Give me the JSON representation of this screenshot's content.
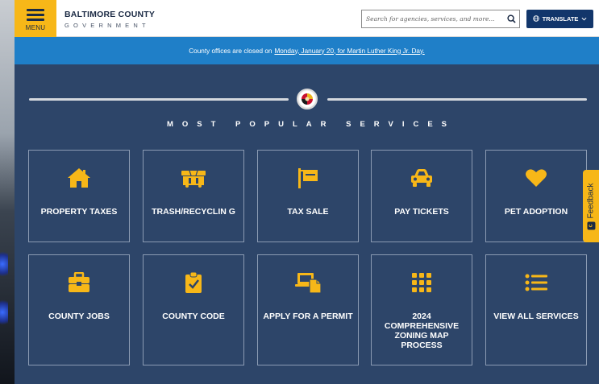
{
  "header": {
    "menu_label": "MENU",
    "brand_name": "BALTIMORE COUNTY",
    "brand_sub": "GOVERNMENT",
    "search_placeholder": "Search for agencies, services, and more...",
    "translate_label": "TRANSLATE"
  },
  "alert": {
    "text": "County offices are closed on",
    "link": "Monday, January 20, for Martin Luther King Jr. Day."
  },
  "services": {
    "title": "MOST POPULAR SERVICES",
    "tiles": [
      {
        "label": "PROPERTY TAXES",
        "icon": "house-icon"
      },
      {
        "label": "TRASH/RECYCLIN G",
        "icon": "dumpster-icon"
      },
      {
        "label": "TAX SALE",
        "icon": "sign-icon"
      },
      {
        "label": "PAY TICKETS",
        "icon": "car-icon"
      },
      {
        "label": "PET ADOPTION",
        "icon": "heart-icon"
      },
      {
        "label": "COUNTY JOBS",
        "icon": "briefcase-icon"
      },
      {
        "label": "COUNTY CODE",
        "icon": "clipboard-check-icon"
      },
      {
        "label": "APPLY FOR A PERMIT",
        "icon": "laptop-document-icon"
      },
      {
        "label": "2024 COMPREHENSIVE ZONING MAP PROCESS",
        "icon": "grid-icon"
      },
      {
        "label": "VIEW ALL SERVICES",
        "icon": "list-icon"
      }
    ]
  },
  "feedback": {
    "label": "Feedback"
  },
  "colors": {
    "accent": "#f7b718",
    "navy": "#2d4569",
    "alert_blue": "#1f7fc8",
    "translate_blue": "#12366b"
  }
}
